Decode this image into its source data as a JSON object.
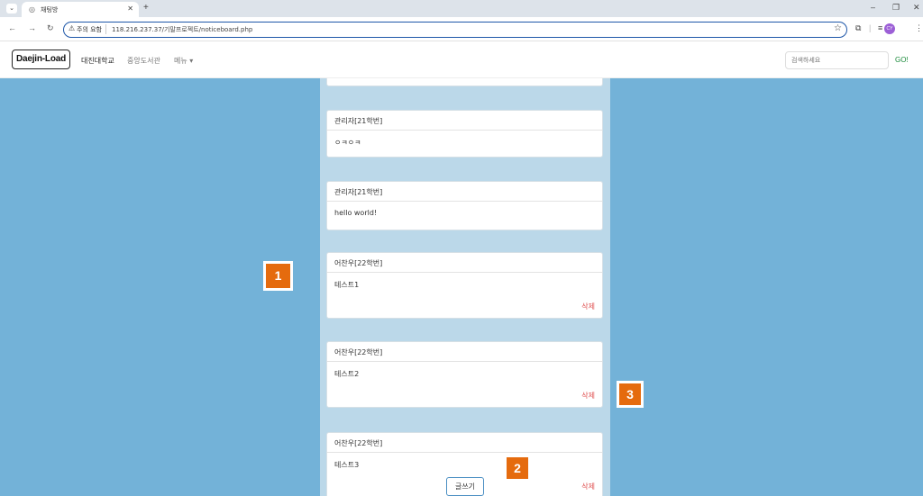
{
  "browser": {
    "tab_title": "채팅방",
    "new_tab_glyph": "+",
    "warning_label": "주의 요함",
    "url": "118.216.237.37/기말프로젝트/noticeboard.php",
    "profile_initials": "CY"
  },
  "navbar": {
    "brand": "Daejin-Load",
    "links": [
      "대진대학교",
      "중앙도서관",
      "메뉴 ▾"
    ],
    "search_placeholder": "검색하세요",
    "go_label": "GO!"
  },
  "posts": [
    {
      "author": "관리자[21학번]",
      "content": "ㅇㅋㅇㅋ",
      "deletable": false
    },
    {
      "author": "관리자[21학번]",
      "content": "hello world!",
      "deletable": false
    },
    {
      "author": "어찬우[22학번]",
      "content": "테스트1",
      "deletable": true,
      "delete_label": "삭제"
    },
    {
      "author": "어찬우[22학번]",
      "content": "테스트2",
      "deletable": true,
      "delete_label": "삭제"
    },
    {
      "author": "어찬우[22학번]",
      "content": "테스트3",
      "deletable": true,
      "delete_label": "삭제"
    }
  ],
  "write_button": "글쓰기",
  "markers": [
    "1",
    "2",
    "3"
  ],
  "colors": {
    "background": "#73b2d8",
    "column": "#bbd8e9",
    "marker": "#e56b0e",
    "delete": "#e05050",
    "go": "#1a8a3a"
  }
}
